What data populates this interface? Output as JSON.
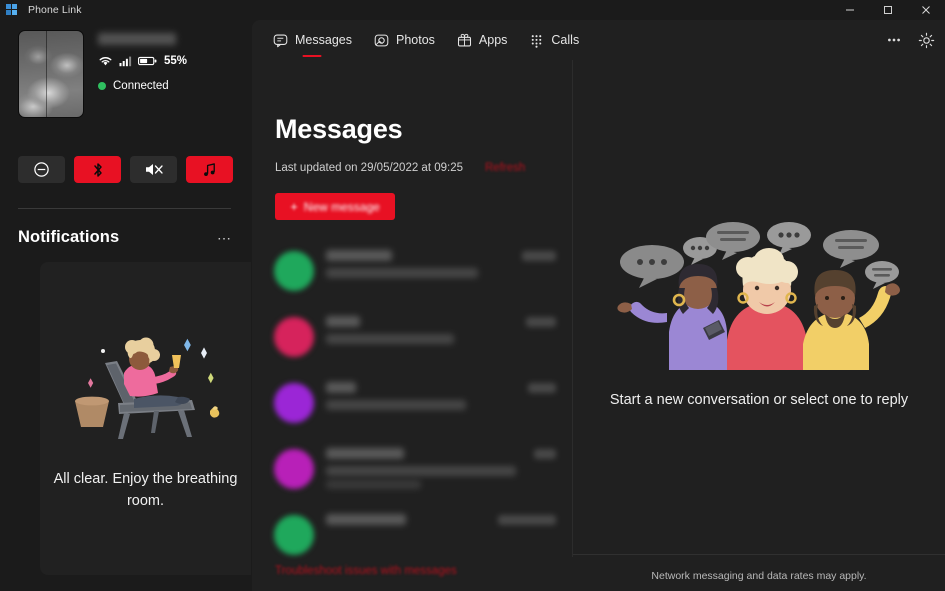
{
  "window": {
    "title": "Phone Link",
    "logo_icon": "phone-link-logo-icon",
    "minimize_label": "─",
    "maximize_label": "☐",
    "close_label": "✕"
  },
  "sidebar": {
    "device": {
      "name_redacted": "",
      "phone_thumbnail_icon": "phone-wallpaper-thumbnail",
      "wifi_icon": "wifi-icon",
      "signal_icon": "cellular-signal-icon",
      "battery_icon": "battery-icon",
      "battery_level": "55%",
      "status": "Connected",
      "status_color": "#2fbf5f"
    },
    "quick_actions": [
      {
        "name": "do-not-disturb",
        "icon": "do-not-disturb-icon",
        "active": false
      },
      {
        "name": "bluetooth",
        "icon": "bluetooth-icon",
        "active": true
      },
      {
        "name": "mute",
        "icon": "volume-mute-icon",
        "active": false
      },
      {
        "name": "media",
        "icon": "music-note-icon",
        "active": true
      }
    ],
    "notifications": {
      "heading": "Notifications",
      "more_icon": "more-options-icon",
      "empty_illustration": "person-relaxing-on-lounge-chair",
      "empty_text": "All clear. Enjoy the breathing room."
    }
  },
  "main": {
    "tabs": [
      {
        "label": "Messages",
        "icon": "message-bubble-icon",
        "active": true
      },
      {
        "label": "Photos",
        "icon": "photo-icon",
        "active": false
      },
      {
        "label": "Apps",
        "icon": "apps-grid-icon",
        "active": false
      },
      {
        "label": "Calls",
        "icon": "dial-pad-icon",
        "active": false
      }
    ],
    "more_icon": "more-options-icon",
    "settings_icon": "gear-icon",
    "accent_color": "#e81123",
    "messages": {
      "title": "Messages",
      "last_updated": "Last updated on 29/05/2022 at 09:25",
      "refresh_label": "Refresh",
      "new_message_label": "New message",
      "new_message_plus_icon": "plus-icon",
      "troubleshoot_label": "Troubleshoot issues with messages",
      "conversations": [
        {
          "avatar_color": "#1fa85c",
          "name_w": 66,
          "prev_w": 152,
          "prev2_w": 0,
          "time_w": 34
        },
        {
          "avatar_color": "#d6235c",
          "name_w": 34,
          "prev_w": 128,
          "prev2_w": 0,
          "time_w": 30
        },
        {
          "avatar_color": "#9b26d6",
          "name_w": 30,
          "prev_w": 140,
          "prev2_w": 0,
          "time_w": 28
        },
        {
          "avatar_color": "#b820b8",
          "name_w": 78,
          "prev_w": 190,
          "prev2_w": 95,
          "time_w": 22
        },
        {
          "avatar_color": "#1fa85c",
          "name_w": 80,
          "prev_w": 0,
          "prev2_w": 0,
          "time_w": 58
        }
      ]
    },
    "detail": {
      "illustration": "three-people-chatting-with-speech-bubbles",
      "empty_text": "Start a new conversation or select one to reply",
      "footer_note": "Network messaging and data rates may apply."
    }
  }
}
